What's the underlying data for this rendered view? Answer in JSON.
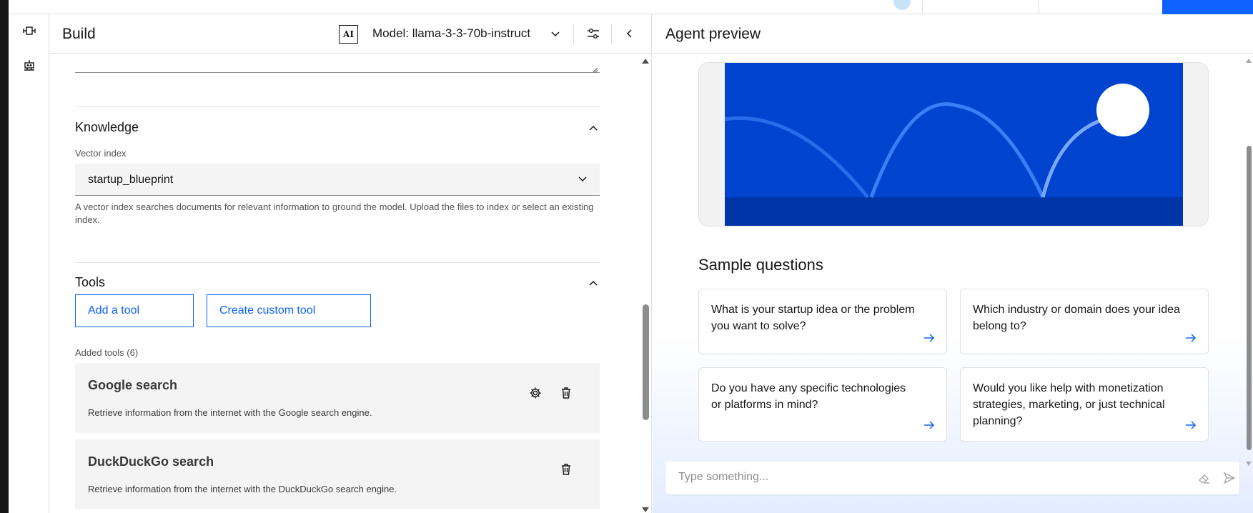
{
  "colors": {
    "accent": "#0f62fe",
    "hero_blue": "#0043ce",
    "surface": "#f4f4f4"
  },
  "rail": {
    "icons": [
      "agent-flow-icon",
      "robot-icon"
    ]
  },
  "build": {
    "title": "Build",
    "ai_badge": "AI",
    "model_label": "Model: llama-3-3-70b-instruct",
    "knowledge": {
      "title": "Knowledge",
      "vector_index_label": "Vector index",
      "vector_index_value": "startup_blueprint",
      "helper": "A vector index searches documents for relevant information to ground the model. Upload the files to index or select an existing index."
    },
    "tools": {
      "title": "Tools",
      "add_tool_label": "Add a tool",
      "create_custom_tool_label": "Create custom tool",
      "added_tools_label": "Added tools (6)",
      "items": [
        {
          "name": "Google search",
          "description": "Retrieve information from the internet with the Google search engine."
        },
        {
          "name": "DuckDuckGo search",
          "description": "Retrieve information from the internet with the DuckDuckGo search engine."
        }
      ]
    }
  },
  "preview": {
    "title": "Agent preview",
    "sample_questions_title": "Sample questions",
    "questions": [
      "What is your startup idea or the problem you want to solve?",
      "Which industry or domain does your idea belong to?",
      "Do you have any specific technologies or platforms in mind?",
      "Would you like help with monetization strategies, marketing, or just technical planning?"
    ],
    "input_placeholder": "Type something..."
  }
}
